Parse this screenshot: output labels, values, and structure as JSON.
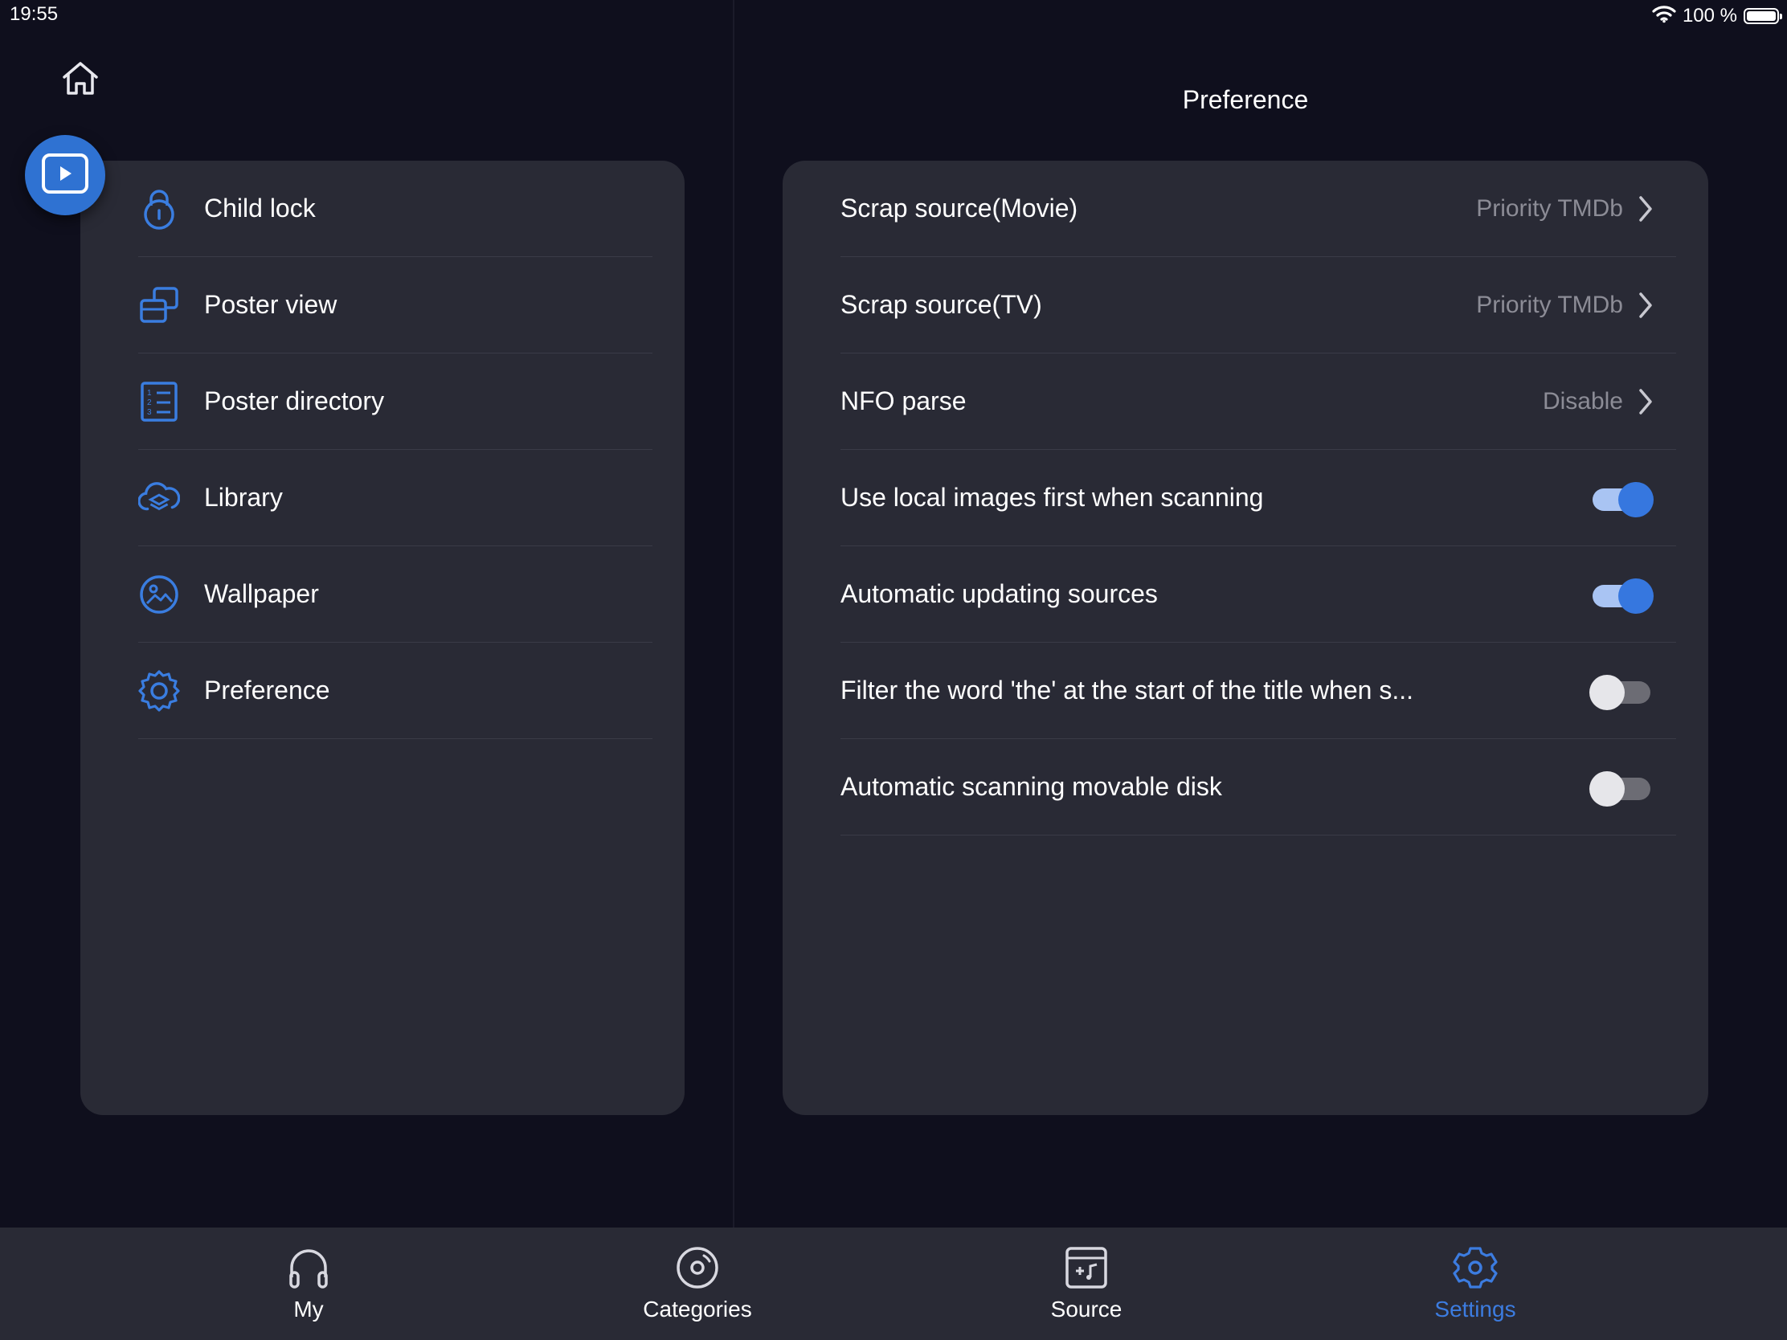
{
  "status_bar": {
    "time": "19:55",
    "battery": "100 %"
  },
  "left_menu": {
    "items": [
      {
        "label": "Child lock",
        "icon": "lock-icon"
      },
      {
        "label": "Poster view",
        "icon": "poster-view-icon"
      },
      {
        "label": "Poster directory",
        "icon": "list-numbered-icon"
      },
      {
        "label": "Library",
        "icon": "cloud-layers-icon"
      },
      {
        "label": "Wallpaper",
        "icon": "image-icon"
      },
      {
        "label": "Preference",
        "icon": "gear-icon"
      }
    ]
  },
  "preference": {
    "title": "Preference",
    "items": [
      {
        "label": "Scrap source(Movie)",
        "value": "Priority TMDb"
      },
      {
        "label": "Scrap source(TV)",
        "value": "Priority TMDb"
      },
      {
        "label": "NFO parse",
        "value": "Disable"
      },
      {
        "label": "Use local images first when scanning",
        "toggle": true
      },
      {
        "label": "Automatic updating sources",
        "toggle": true
      },
      {
        "label": "Filter the word 'the' at the start of the title when s...",
        "toggle": false
      },
      {
        "label": "Automatic scanning movable disk",
        "toggle": false
      }
    ]
  },
  "tabbar": {
    "tabs": [
      {
        "label": "My",
        "icon": "headphones-icon"
      },
      {
        "label": "Categories",
        "icon": "disc-icon"
      },
      {
        "label": "Source",
        "icon": "source-folder-icon"
      },
      {
        "label": "Settings",
        "icon": "gear-icon",
        "active": true
      }
    ]
  },
  "colors": {
    "background": "#0f0f1d",
    "panel": "#292a35",
    "accent": "#3677df",
    "secondary_text": "#8c8c96"
  }
}
